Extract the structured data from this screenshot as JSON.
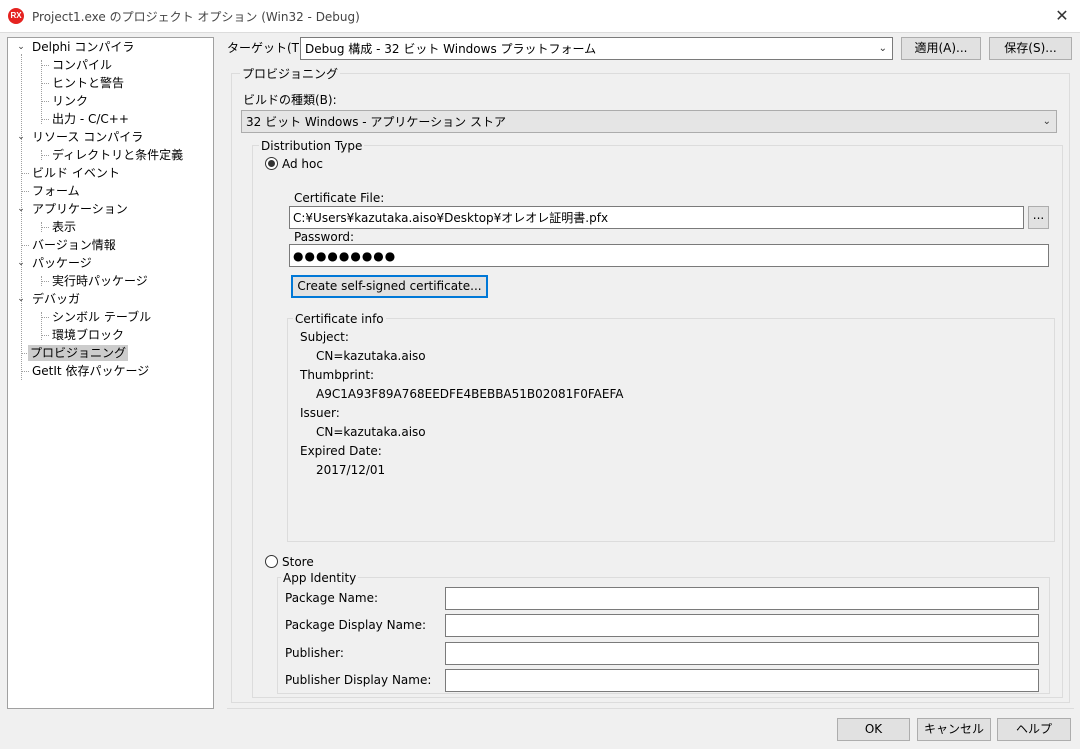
{
  "window": {
    "icon_text": "RX",
    "title": "Project1.exe のプロジェクト オプション  (Win32 - Debug)",
    "close_glyph": "✕"
  },
  "tree": [
    {
      "label": "Delphi コンパイラ",
      "level": 0,
      "expanded": true
    },
    {
      "label": "コンパイル",
      "level": 1
    },
    {
      "label": "ヒントと警告",
      "level": 1
    },
    {
      "label": "リンク",
      "level": 1
    },
    {
      "label": "出力 - C/C++",
      "level": 1
    },
    {
      "label": "リソース コンパイラ",
      "level": 0,
      "expanded": true
    },
    {
      "label": "ディレクトリと条件定義",
      "level": 1
    },
    {
      "label": "ビルド イベント",
      "level": 0
    },
    {
      "label": "フォーム",
      "level": 0
    },
    {
      "label": "アプリケーション",
      "level": 0,
      "expanded": true
    },
    {
      "label": "表示",
      "level": 1
    },
    {
      "label": "バージョン情報",
      "level": 0
    },
    {
      "label": "パッケージ",
      "level": 0,
      "expanded": true
    },
    {
      "label": "実行時パッケージ",
      "level": 1
    },
    {
      "label": "デバッガ",
      "level": 0,
      "expanded": true
    },
    {
      "label": "シンボル テーブル",
      "level": 1
    },
    {
      "label": "環境ブロック",
      "level": 1
    },
    {
      "label": "プロビジョニング",
      "level": 0,
      "selected": true
    },
    {
      "label": "GetIt 依存パッケージ",
      "level": 0
    }
  ],
  "target": {
    "label": "ターゲット(T):",
    "value": "Debug 構成 - 32 ビット Windows プラットフォーム",
    "apply_label": "適用(A)...",
    "save_label": "保存(S)..."
  },
  "provisioning": {
    "group_title": "プロビジョニング",
    "build_type_label": "ビルドの種類(B):",
    "build_type_value": "32 ビット Windows - アプリケーション ストア",
    "distribution": {
      "title": "Distribution Type",
      "adhoc_label": "Ad hoc",
      "adhoc_selected": true,
      "certificate_file_label": "Certificate File:",
      "certificate_file_value": "C:¥Users¥kazutaka.aiso¥Desktop¥オレオレ証明書.pfx",
      "browse_label": "...",
      "password_label": "Password:",
      "password_value": "●●●●●●●●●",
      "create_cert_label": "Create self-signed certificate...",
      "cert_info": {
        "title": "Certificate info",
        "subject_label": "Subject:",
        "subject_value": "CN=kazutaka.aiso",
        "thumbprint_label": "Thumbprint:",
        "thumbprint_value": "A9C1A93F89A768EEDFE4BEBBA51B02081F0FAEFA",
        "issuer_label": "Issuer:",
        "issuer_value": "CN=kazutaka.aiso",
        "expired_label": "Expired Date:",
        "expired_value": "2017/12/01"
      },
      "store_label": "Store",
      "store_selected": false,
      "app_identity": {
        "title": "App Identity",
        "package_name_label": "Package Name:",
        "package_name_value": "",
        "package_display_name_label": "Package Display Name:",
        "package_display_name_value": "",
        "publisher_label": "Publisher:",
        "publisher_value": "",
        "publisher_display_name_label": "Publisher Display Name:",
        "publisher_display_name_value": ""
      }
    }
  },
  "footer": {
    "ok_label": "OK",
    "cancel_label": "キャンセル",
    "help_label": "ヘルプ"
  }
}
